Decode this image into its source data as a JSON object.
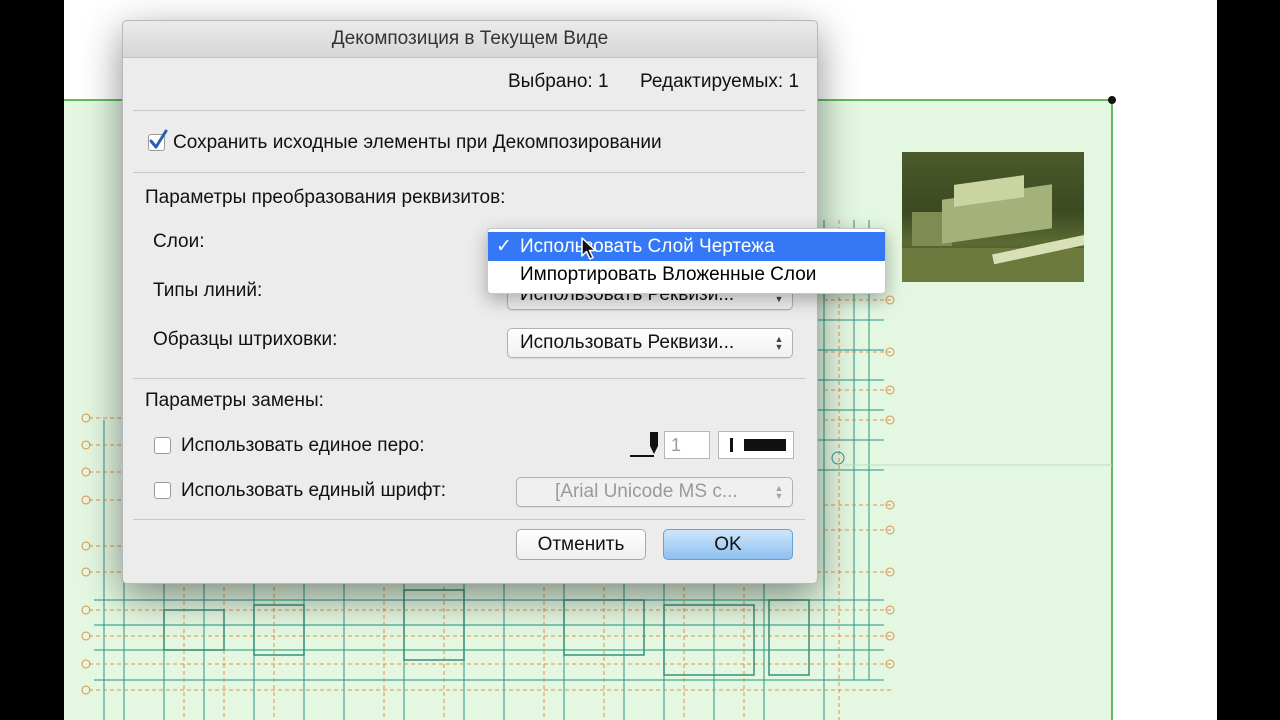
{
  "dialog": {
    "title": "Декомпозиция в Текущем Виде",
    "selected_label": "Выбрано: 1",
    "editable_label": "Редактируемых: 1",
    "keep_originals": {
      "label": "Сохранить исходные элементы при Декомпозировании",
      "checked": true
    },
    "conversion_section": "Параметры преобразования реквизитов:",
    "layers": {
      "label": "Слои:"
    },
    "line_types": {
      "label": "Типы линий:",
      "value": "Использовать Реквизи..."
    },
    "fill_patterns": {
      "label": "Образцы штриховки:",
      "value": "Использовать Реквизи..."
    },
    "replace_section": "Параметры замены:",
    "single_pen": {
      "label": "Использовать единое перо:",
      "checked": false,
      "pen_number": "1"
    },
    "single_font": {
      "label": "Использовать единый шрифт:",
      "checked": false,
      "value": "[Arial Unicode MS c..."
    },
    "cancel_label": "Отменить",
    "ok_label": "OK"
  },
  "layers_menu": {
    "items": [
      {
        "label": "Использовать Слой Чертежа",
        "selected": true,
        "check": "✓"
      },
      {
        "label": "Импортировать Вложенные Слои",
        "selected": false,
        "check": ""
      }
    ]
  },
  "colors": {
    "selection_fill": "#e3f7e1",
    "selection_border": "#5dbd5a",
    "menu_highlight": "#3478f6",
    "default_button": "#8ec0f0"
  }
}
